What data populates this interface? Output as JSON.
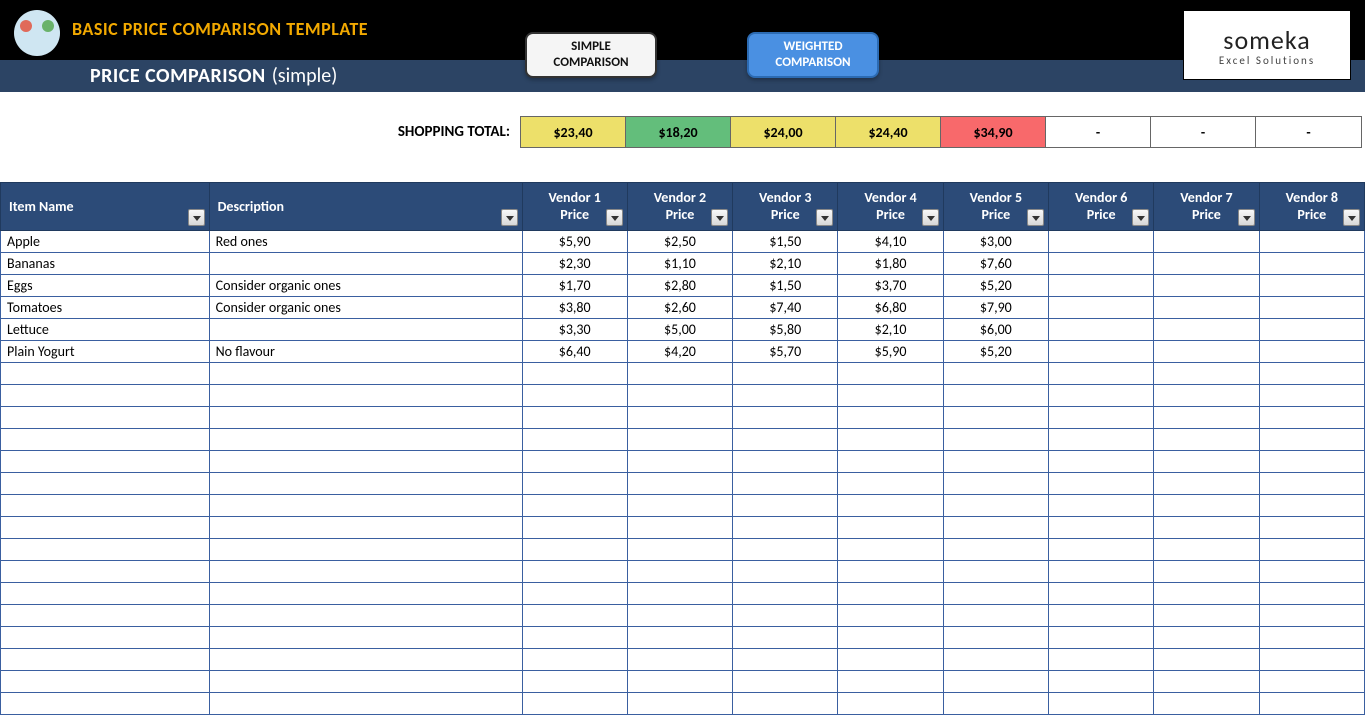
{
  "header": {
    "title_main": "BASIC PRICE COMPARISON TEMPLATE",
    "subtitle_bold": "PRICE COMPARISON",
    "subtitle_paren": "(simple)",
    "logo_name": "someka",
    "logo_tag": "Excel Solutions"
  },
  "nav": {
    "simple_l1": "SIMPLE",
    "simple_l2": "COMPARISON",
    "weighted_l1": "WEIGHTED",
    "weighted_l2": "COMPARISON"
  },
  "totals": {
    "label": "SHOPPING TOTAL:",
    "cells": [
      {
        "value": "$23,40",
        "cls": "tc-y"
      },
      {
        "value": "$18,20",
        "cls": "tc-g"
      },
      {
        "value": "$24,00",
        "cls": "tc-y"
      },
      {
        "value": "$24,40",
        "cls": "tc-y"
      },
      {
        "value": "$34,90",
        "cls": "tc-r"
      },
      {
        "value": "-",
        "cls": "tc-w"
      },
      {
        "value": "-",
        "cls": "tc-w"
      },
      {
        "value": "-",
        "cls": "tc-w"
      }
    ]
  },
  "columns": {
    "item_name": "Item Name",
    "description": "Description",
    "vendor_price": [
      "Vendor 1 Price",
      "Vendor 2 Price",
      "Vendor 3 Price",
      "Vendor 4 Price",
      "Vendor 5 Price",
      "Vendor 6 Price",
      "Vendor 7 Price",
      "Vendor 8 Price"
    ]
  },
  "rows": [
    {
      "name": "Apple",
      "desc": "Red ones",
      "p": [
        "$5,90",
        "$2,50",
        "$1,50",
        "$4,10",
        "$3,00",
        "",
        "",
        ""
      ]
    },
    {
      "name": "Bananas",
      "desc": "",
      "p": [
        "$2,30",
        "$1,10",
        "$2,10",
        "$1,80",
        "$7,60",
        "",
        "",
        ""
      ]
    },
    {
      "name": "Eggs",
      "desc": "Consider organic ones",
      "p": [
        "$1,70",
        "$2,80",
        "$1,50",
        "$3,70",
        "$5,20",
        "",
        "",
        ""
      ]
    },
    {
      "name": "Tomatoes",
      "desc": "Consider organic ones",
      "p": [
        "$3,80",
        "$2,60",
        "$7,40",
        "$6,80",
        "$7,90",
        "",
        "",
        ""
      ]
    },
    {
      "name": "Lettuce",
      "desc": "",
      "p": [
        "$3,30",
        "$5,00",
        "$5,80",
        "$2,10",
        "$6,00",
        "",
        "",
        ""
      ]
    },
    {
      "name": "Plain Yogurt",
      "desc": "No flavour",
      "p": [
        "$6,40",
        "$4,20",
        "$5,70",
        "$5,90",
        "$5,20",
        "",
        "",
        ""
      ]
    }
  ],
  "empty_rows": 16
}
